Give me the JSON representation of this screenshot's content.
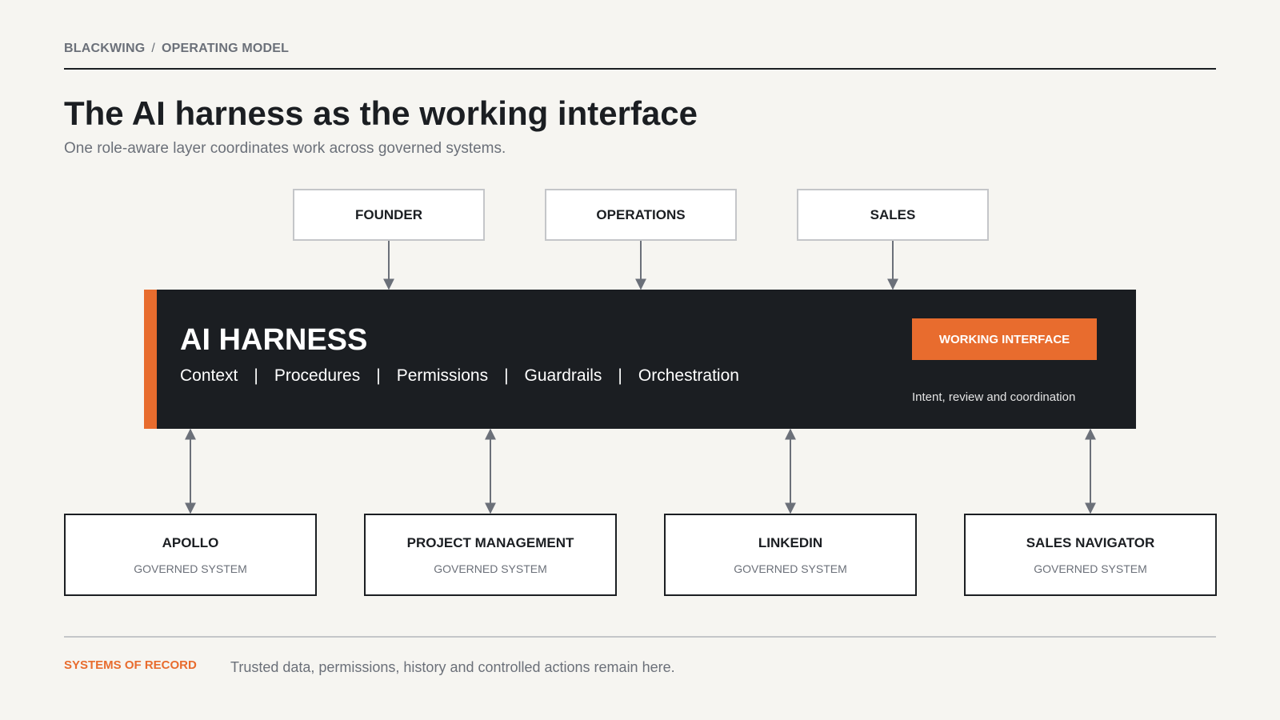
{
  "breadcrumb": {
    "company": "BLACKWING",
    "separator": "/",
    "section": "OPERATING MODEL"
  },
  "title": "The AI harness as the working interface",
  "subtitle": "One role-aware layer coordinates work across governed systems.",
  "roles": [
    "FOUNDER",
    "OPERATIONS",
    "SALES"
  ],
  "harness": {
    "title": "AI HARNESS",
    "capabilities": [
      "Context",
      "Procedures",
      "Permissions",
      "Guardrails",
      "Orchestration"
    ],
    "divider": "|",
    "badge": "WORKING INTERFACE",
    "badge_caption": "Intent, review and coordination"
  },
  "systems": [
    {
      "name": "APOLLO",
      "type": "GOVERNED SYSTEM"
    },
    {
      "name": "PROJECT MANAGEMENT",
      "type": "GOVERNED SYSTEM"
    },
    {
      "name": "LINKEDIN",
      "type": "GOVERNED SYSTEM"
    },
    {
      "name": "SALES NAVIGATOR",
      "type": "GOVERNED SYSTEM"
    }
  ],
  "footer": {
    "label": "SYSTEMS OF RECORD",
    "text": "Trusted data, permissions, history and controlled actions remain here."
  },
  "colors": {
    "accent": "#e86c2e",
    "dark": "#1b1e22",
    "muted": "#6b7079",
    "background": "#f6f5f1",
    "connector": "#6b7079"
  }
}
